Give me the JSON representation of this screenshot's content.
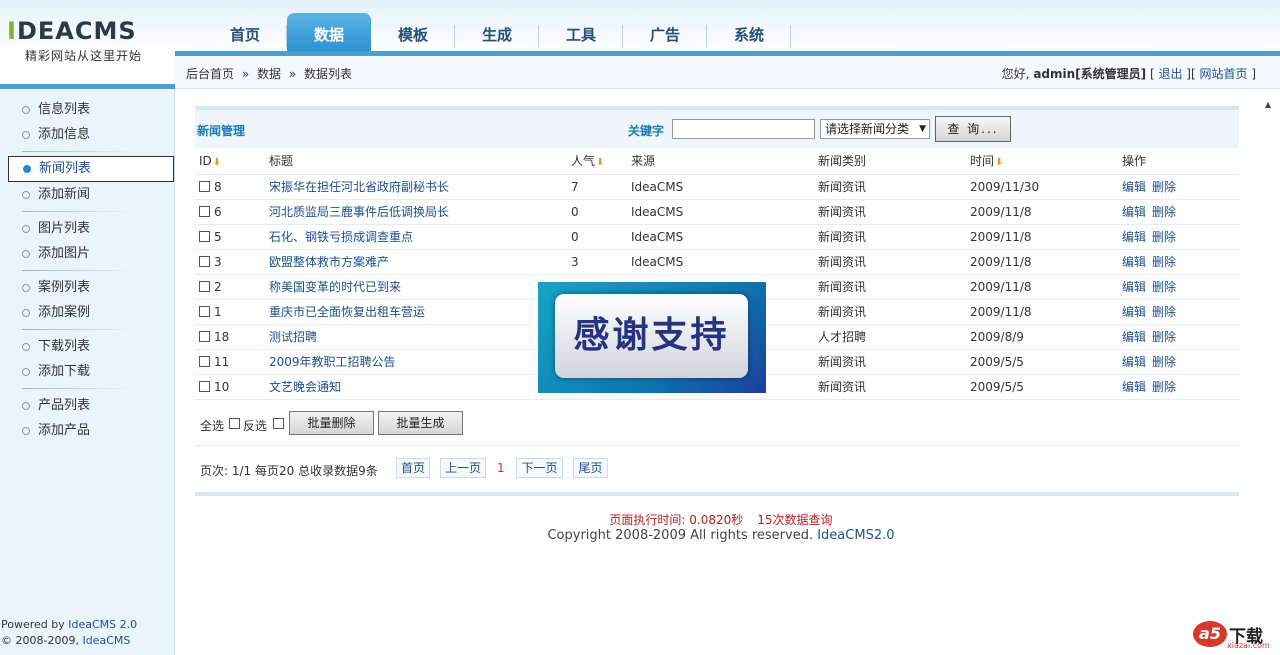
{
  "logo": {
    "brand": "IDEACMS",
    "slogan": "精彩网站从这里开始"
  },
  "nav": {
    "tabs": [
      {
        "label": "首页"
      },
      {
        "label": "数据",
        "active": true
      },
      {
        "label": "模板"
      },
      {
        "label": "生成"
      },
      {
        "label": "工具"
      },
      {
        "label": "广告"
      },
      {
        "label": "系统"
      }
    ]
  },
  "breadcrumb": {
    "home": "后台首页",
    "sep": "»",
    "section": "数据",
    "current": "数据列表"
  },
  "user": {
    "greeting": "您好,",
    "name": "admin[系统管理员]",
    "logout": "退出",
    "site_home": "网站首页"
  },
  "sidebar": {
    "groups": [
      {
        "items": [
          "信息列表",
          "添加信息"
        ]
      },
      {
        "items": [
          "新闻列表",
          "添加新闻"
        ]
      },
      {
        "items": [
          "图片列表",
          "添加图片"
        ]
      },
      {
        "items": [
          "案例列表",
          "添加案例"
        ]
      },
      {
        "items": [
          "下载列表",
          "添加下载"
        ]
      },
      {
        "items": [
          "产品列表",
          "添加产品"
        ]
      }
    ],
    "active": "新闻列表",
    "powered_prefix": "Powered by",
    "powered_brand": "IdeaCMS 2.0",
    "copyright_prefix": "© 2008-2009,",
    "copyright_brand": "IdeaCMS"
  },
  "panel": {
    "title": "新闻管理",
    "keyword_label": "关键字",
    "keyword_value": "",
    "category_select": "请选择新闻分类",
    "search_button": "查 询..."
  },
  "table": {
    "headers": [
      "ID",
      "标题",
      "人气",
      "来源",
      "新闻类别",
      "时间",
      "操作"
    ],
    "rows": [
      {
        "id": "8",
        "title": "宋振华在担任河北省政府副秘书长",
        "hits": "7",
        "source": "IdeaCMS",
        "category": "新闻资讯",
        "date": "2009/11/30"
      },
      {
        "id": "6",
        "title": "河北质监局三鹿事件后低调换局长",
        "hits": "0",
        "source": "IdeaCMS",
        "category": "新闻资讯",
        "date": "2009/11/8"
      },
      {
        "id": "5",
        "title": "石化、钢铁亏损成调查重点",
        "hits": "0",
        "source": "IdeaCMS",
        "category": "新闻资讯",
        "date": "2009/11/8"
      },
      {
        "id": "3",
        "title": "欧盟整体救市方案难产",
        "hits": "3",
        "source": "IdeaCMS",
        "category": "新闻资讯",
        "date": "2009/11/8"
      },
      {
        "id": "2",
        "title": "称美国变革的时代已到来",
        "hits": "",
        "source": "",
        "category": "新闻资讯",
        "date": "2009/11/8"
      },
      {
        "id": "1",
        "title": "重庆市已全面恢复出租车营运",
        "hits": "",
        "source": "",
        "category": "新闻资讯",
        "date": "2009/11/8"
      },
      {
        "id": "18",
        "title": "测试招聘",
        "hits": "",
        "source": "",
        "category": "人才招聘",
        "date": "2009/8/9"
      },
      {
        "id": "11",
        "title": "2009年教职工招聘公告",
        "hits": "",
        "source": "",
        "category": "新闻资讯",
        "date": "2009/5/5"
      },
      {
        "id": "10",
        "title": "文艺晚会通知",
        "hits": "",
        "source": "",
        "category": "新闻资讯",
        "date": "2009/5/5"
      }
    ],
    "edit_label": "编辑",
    "delete_label": "删除"
  },
  "batch": {
    "select_all": "全选",
    "invert": "反选",
    "batch_delete": "批量删除",
    "batch_generate": "批量生成"
  },
  "pager": {
    "info": "页次: 1/1 每页20 总收录数据9条",
    "first": "首页",
    "prev": "上一页",
    "current": "1",
    "next": "下一页",
    "last": "尾页"
  },
  "footer": {
    "exec_time": "页面执行时间: 0.0820秒",
    "queries": "15次数据查询",
    "copyright": "Copyright 2008-2009 All rights reserved.",
    "brand": "IdeaCMS2.0"
  },
  "overlay": {
    "thanks": "感谢支持"
  },
  "watermark": {
    "logo": "a5",
    "text": "下载",
    "url": "xiazai.com"
  },
  "colors": {
    "accent": "#2b8fd1",
    "link": "#1f4f8a",
    "panel_title": "#1d7cb4",
    "sort_arrow": "#e79a2c",
    "footer_red": "#b22222"
  }
}
